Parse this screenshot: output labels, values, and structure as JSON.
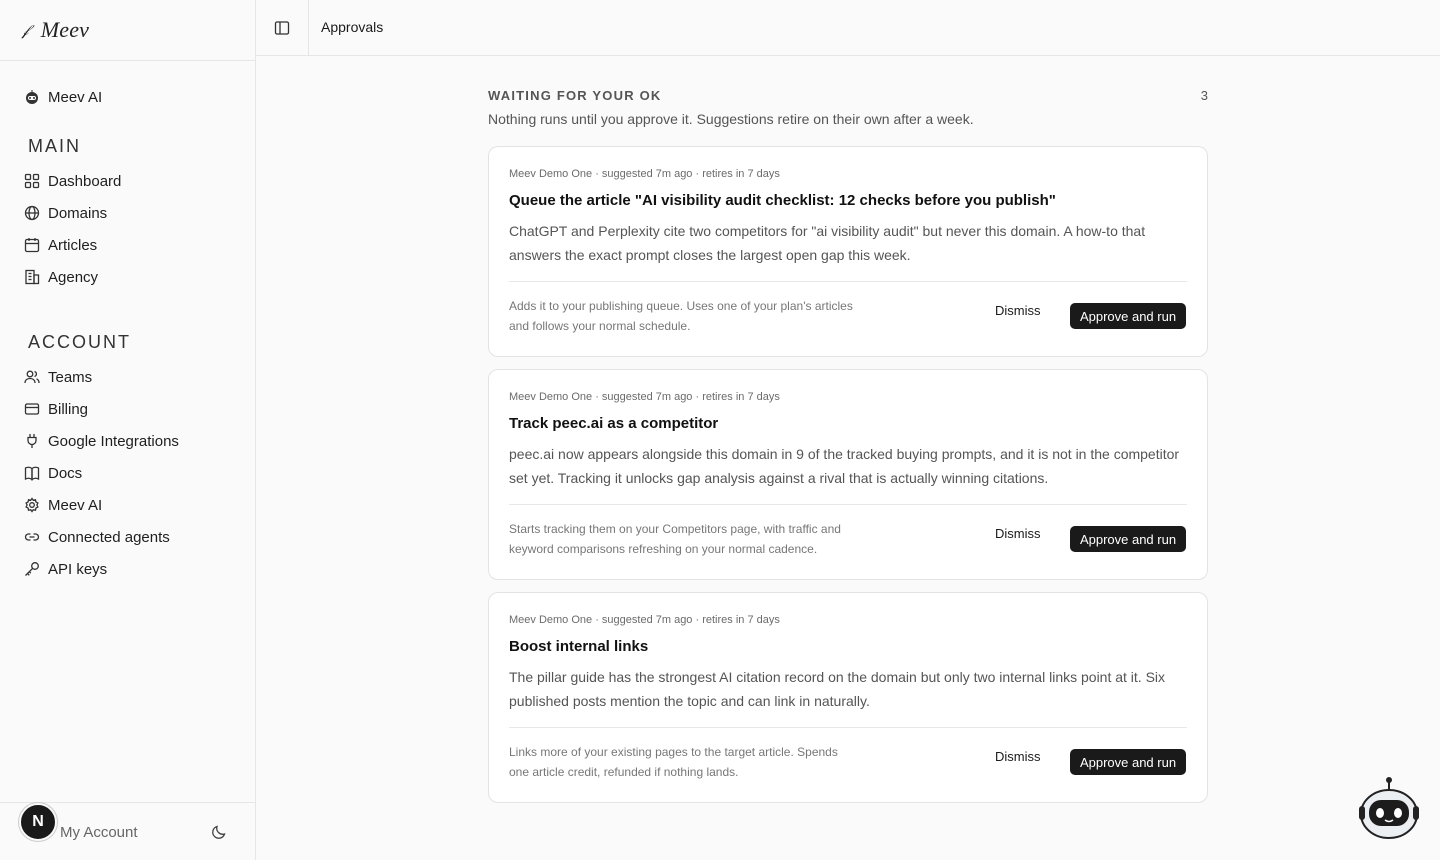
{
  "brand": {
    "name": "Meev"
  },
  "sidebar": {
    "top_item": {
      "label": "Meev AI",
      "icon": "robot-icon"
    },
    "main_label": "MAIN",
    "main_items": [
      {
        "label": "Dashboard",
        "icon": "grid-icon"
      },
      {
        "label": "Domains",
        "icon": "globe-icon"
      },
      {
        "label": "Articles",
        "icon": "calendar-icon"
      },
      {
        "label": "Agency",
        "icon": "building-icon"
      }
    ],
    "account_label": "ACCOUNT",
    "account_items": [
      {
        "label": "Teams",
        "icon": "users-icon"
      },
      {
        "label": "Billing",
        "icon": "credit-card-icon"
      },
      {
        "label": "Google Integrations",
        "icon": "plug-icon"
      },
      {
        "label": "Docs",
        "icon": "book-icon"
      },
      {
        "label": "Meev AI",
        "icon": "gear-icon"
      },
      {
        "label": "Connected agents",
        "icon": "link-icon"
      },
      {
        "label": "API keys",
        "icon": "key-icon"
      }
    ],
    "account": {
      "avatar_letter": "N",
      "label": "My Account"
    }
  },
  "header": {
    "title": "Approvals"
  },
  "main": {
    "heading": "WAITING FOR YOUR OK",
    "count": "3",
    "subtitle": "Nothing runs until you approve it. Suggestions retire on their own after a week.",
    "cards": [
      {
        "meta": "Meev Demo One · suggested 7m ago · retires in 7 days",
        "title": "Queue the article \"AI visibility audit checklist: 12 checks before you publish\"",
        "body": "ChatGPT and Perplexity cite two competitors for \"ai visibility audit\" but never this domain. A how-to that answers the exact prompt closes the largest open gap this week.",
        "note": "Adds it to your publishing queue. Uses one of your plan's articles and follows your normal schedule.",
        "dismiss": "Dismiss",
        "approve": "Approve and run"
      },
      {
        "meta": "Meev Demo One · suggested 7m ago · retires in 7 days",
        "title": "Track peec.ai as a competitor",
        "body": "peec.ai now appears alongside this domain in 9 of the tracked buying prompts, and it is not in the competitor set yet. Tracking it unlocks gap analysis against a rival that is actually winning citations.",
        "note": "Starts tracking them on your Competitors page, with traffic and keyword comparisons refreshing on your normal cadence.",
        "dismiss": "Dismiss",
        "approve": "Approve and run"
      },
      {
        "meta": "Meev Demo One · suggested 7m ago · retires in 7 days",
        "title": "Boost internal links",
        "body": "The pillar guide has the strongest AI citation record on the domain but only two internal links point at it. Six published posts mention the topic and can link in naturally.",
        "note": "Links more of your existing pages to the target article. Spends one article credit, refunded if nothing lands.",
        "dismiss": "Dismiss",
        "approve": "Approve and run"
      }
    ]
  }
}
